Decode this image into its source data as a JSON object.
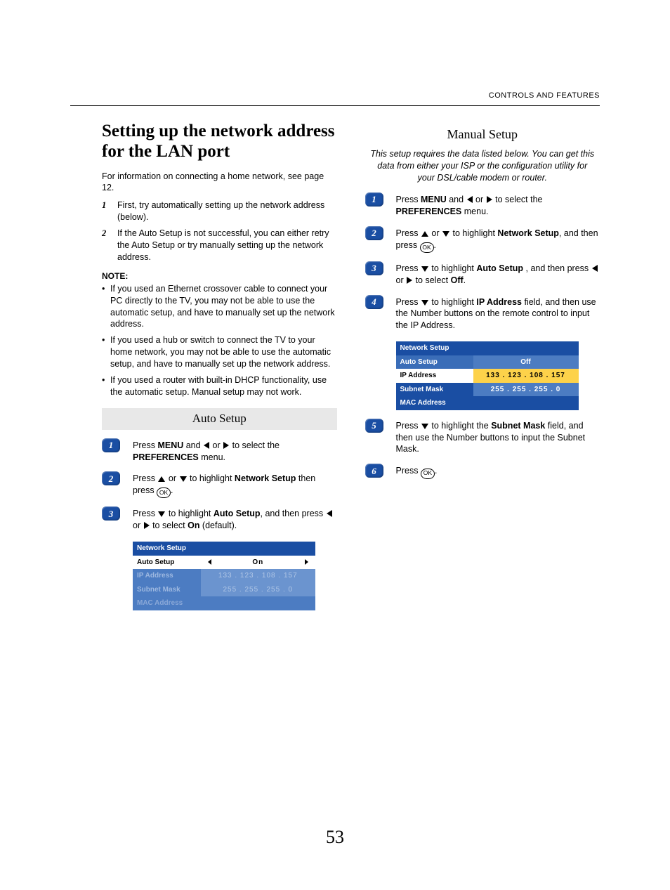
{
  "header": {
    "section": "CONTROLS AND FEATURES"
  },
  "title": "Setting up the network address for the LAN port",
  "intro": "For information on connecting a home network, see page 12.",
  "initialSteps": [
    {
      "n": "1",
      "text": "First, try automatically setting up the network address (below)."
    },
    {
      "n": "2",
      "text": "If the Auto Setup is not successful, you can either retry the Auto Setup or try manually setting up the network address."
    }
  ],
  "noteLabel": "NOTE:",
  "notes": [
    "If you used an Ethernet crossover cable to connect your PC directly to the TV, you may not be able to use the automatic setup, and have to manually set up the network address.",
    "If you used a hub or switch to connect the TV to your home network, you may not be able to use the automatic setup, and have to manually set up the network address.",
    "If you used a router with built-in DHCP functionality, use the automatic setup. Manual setup may not work."
  ],
  "autoSetup": {
    "heading": "Auto Setup",
    "steps": {
      "s1": {
        "pre": "Press ",
        "menu": "MENU",
        "mid": " and ",
        "post": " to select the ",
        "pref": "PREFERENCES",
        "end": " menu."
      },
      "s2": {
        "pre": "Press ",
        "mid": " or ",
        "post": " to highlight ",
        "ns": "Network Setup",
        "end": " then press "
      },
      "s3": {
        "pre": "Press ",
        "mid": " to highlight ",
        "as": "Auto Setup",
        "post": ", and then press ",
        "or": " or ",
        "sel": " to select ",
        "on": "On",
        "end": " (default)."
      }
    },
    "table": {
      "title": "Network Setup",
      "autoLabel": "Auto Setup",
      "autoValue": "On",
      "ipLabel": "IP Address",
      "ipValue": "133  .  123  .  108  .  157",
      "subnetLabel": "Subnet Mask",
      "subnetValue": "255  .  255  .  255  .   0",
      "macLabel": "MAC Address"
    }
  },
  "manualSetup": {
    "heading": "Manual Setup",
    "intro": "This setup requires the data listed below. You can get this data from either your ISP or the configuration utility for your DSL/cable modem or router.",
    "steps": {
      "s1": {
        "pre": "Press ",
        "menu": "MENU",
        "mid": " and ",
        "post": " to select the ",
        "pref": "PREFERENCES",
        "end": " menu."
      },
      "s2": {
        "pre": "Press ",
        "mid": " or ",
        "post": " to highlight ",
        "ns": "Network Setup",
        "end": ", and then press "
      },
      "s3": {
        "pre": "Press ",
        "mid": " to highlight ",
        "as": "Auto Setup ",
        "post": ", and then press ",
        "or": " or ",
        "sel": " to select ",
        "off": "Off",
        "end": "."
      },
      "s4": {
        "pre": "Press ",
        "mid": " to highlight ",
        "ip": "IP Address",
        "post": " field, and then use the Number buttons on the remote control to input the IP Address."
      },
      "s5": {
        "pre": "Press ",
        "mid": " to highlight the ",
        "sm": "Subnet Mask",
        "post": " field, and then use the Number buttons to input the Subnet Mask."
      },
      "s6": {
        "pre": "Press "
      }
    },
    "table": {
      "title": "Network Setup",
      "autoLabel": "Auto Setup",
      "autoValue": "Off",
      "ipLabel": "IP Address",
      "ipValue": "133  .  123  .  108  .  157",
      "subnetLabel": "Subnet Mask",
      "subnetValue": "255  .  255  .  255  .   0",
      "macLabel": "MAC Address"
    }
  },
  "pageNumber": "53"
}
